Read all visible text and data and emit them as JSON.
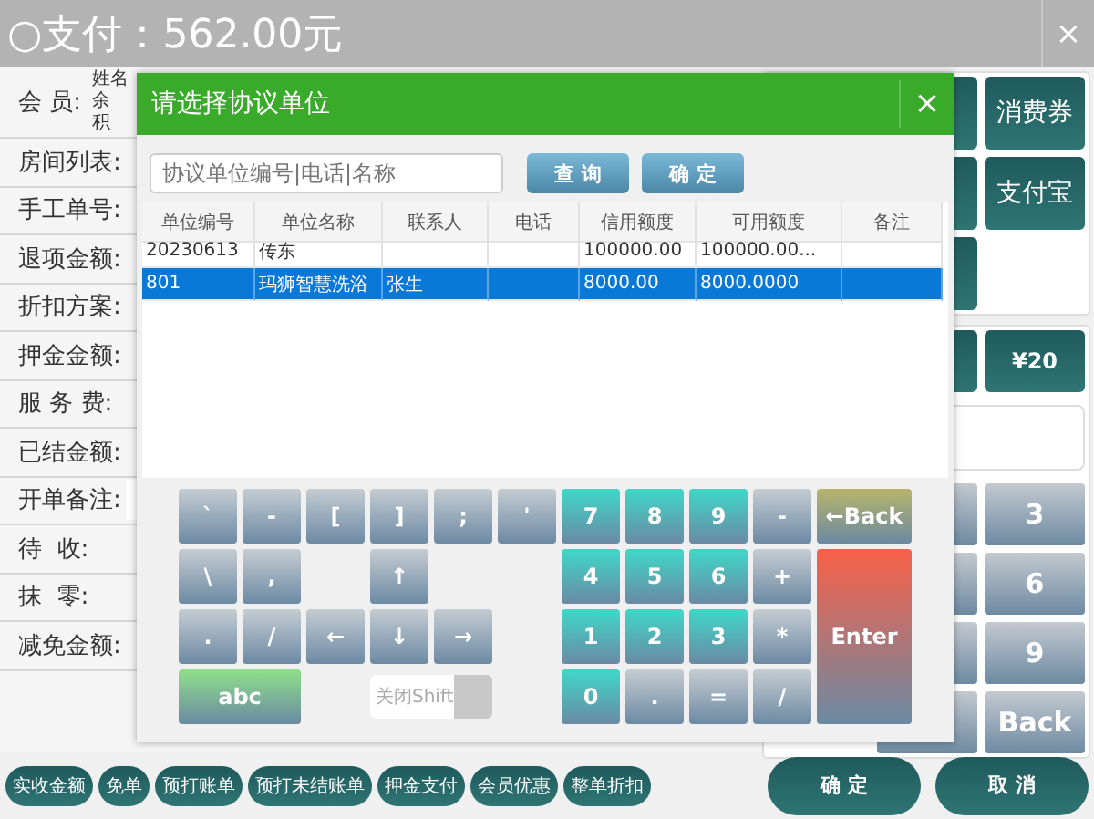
{
  "window": {
    "title": "○支付：562.00元",
    "close": "×"
  },
  "member": {
    "label": "会 员:",
    "fields": [
      "姓名",
      "余",
      "积"
    ]
  },
  "form_rows": [
    {
      "label": "房间列表:",
      "kind": "label"
    },
    {
      "label": "手工单号:",
      "kind": "label"
    },
    {
      "label": "退项金额:",
      "kind": "label"
    },
    {
      "label": "折扣方案:",
      "kind": "label"
    },
    {
      "label": "押金金额:",
      "kind": "label"
    },
    {
      "label": "服 务 费:",
      "kind": "label"
    },
    {
      "label": "已结金额:",
      "kind": "label"
    },
    {
      "label": "开单备注:",
      "kind": "field"
    },
    {
      "label": "待  收:",
      "kind": "label"
    },
    {
      "label": "抹  零:",
      "kind": "label"
    },
    {
      "label": "减免金额:",
      "kind": "label"
    }
  ],
  "pay_buttons": [
    "消费券",
    "支付宝"
  ],
  "amount_buttons": [
    "¥20"
  ],
  "numpad": [
    "3",
    "6",
    "9",
    "Back"
  ],
  "dialog": {
    "title": "请选择协议单位",
    "close": "×",
    "search": {
      "placeholder": "协议单位编号|电话|名称"
    },
    "buttons": [
      "查 询",
      "确 定"
    ],
    "table": {
      "columns": [
        "单位编号",
        "单位名称",
        "联系人",
        "电话",
        "信用额度",
        "可用额度",
        "备注"
      ],
      "rows": [
        {
          "cells": [
            "20230613",
            "传东",
            "",
            "",
            "100000.00",
            "100000.00...",
            ""
          ],
          "selected": false
        },
        {
          "cells": [
            "801",
            "玛狮智慧洗浴",
            "张生",
            "",
            "8000.00",
            "8000.0000",
            ""
          ],
          "selected": true
        }
      ]
    },
    "keys": [
      {
        "key": "`",
        "kind": "char"
      },
      {
        "key": "-",
        "kind": "char"
      },
      {
        "key": "[",
        "kind": "char"
      },
      {
        "key": "]",
        "kind": "char"
      },
      {
        "key": ";",
        "kind": "char"
      },
      {
        "key": "'",
        "kind": "char"
      },
      {
        "key": "7",
        "kind": "digit"
      },
      {
        "key": "8",
        "kind": "digit"
      },
      {
        "key": "9",
        "kind": "digit"
      },
      {
        "key": "-",
        "kind": "char"
      },
      {
        "key": "←Back",
        "kind": "back"
      },
      {
        "key": "\\",
        "kind": "char"
      },
      {
        "key": ",",
        "kind": "char"
      },
      {
        "key": "↑",
        "kind": "char"
      },
      {
        "key": "4",
        "kind": "digit"
      },
      {
        "key": "5",
        "kind": "digit"
      },
      {
        "key": "6",
        "kind": "digit"
      },
      {
        "key": "+",
        "kind": "char"
      },
      {
        "key": ".",
        "kind": "char"
      },
      {
        "key": "/",
        "kind": "char"
      },
      {
        "key": "←",
        "kind": "char"
      },
      {
        "key": "↓",
        "kind": "char"
      },
      {
        "key": "→",
        "kind": "char"
      },
      {
        "key": "1",
        "kind": "digit"
      },
      {
        "key": "2",
        "kind": "digit"
      },
      {
        "key": "3",
        "kind": "digit"
      },
      {
        "key": "*",
        "kind": "char"
      },
      {
        "key": "Enter",
        "kind": "enter"
      },
      {
        "key": "abc",
        "kind": "abc"
      },
      {
        "key": "关闭Shift",
        "kind": "toggle",
        "on": true
      },
      {
        "key": "0",
        "kind": "digit"
      },
      {
        "key": ".",
        "kind": "char"
      },
      {
        "key": "=",
        "kind": "char"
      },
      {
        "key": "/",
        "kind": "char"
      }
    ]
  },
  "footer": {
    "actions": [
      "实收金额",
      "免单",
      "预打账单",
      "预打未结账单",
      "押金支付",
      "会员优惠",
      "整单折扣"
    ],
    "buttons": [
      "确 定",
      "取 消"
    ]
  }
}
